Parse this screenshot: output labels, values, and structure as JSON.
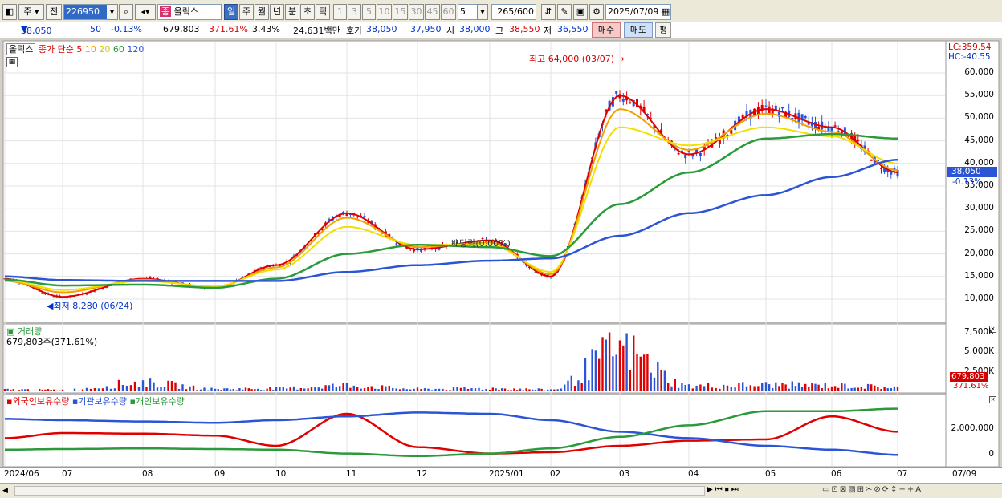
{
  "toolbar": {
    "period_select": "주",
    "prev_label": "전",
    "code": "226950",
    "stock_badge": "종",
    "stock_name": "올릭스",
    "periods": [
      "일",
      "주",
      "월",
      "년",
      "분",
      "초",
      "틱"
    ],
    "active_period": "일",
    "intervals": [
      "1",
      "3",
      "5",
      "10",
      "15",
      "30",
      "45",
      "60"
    ],
    "interval_value": "5",
    "count": "265",
    "count_max": "/600",
    "date": "2025/07/09"
  },
  "quote": {
    "price": "38,050",
    "change": "50",
    "change_pct": "-0.13%",
    "volume": "679,803",
    "vol_ratio": "371.61%",
    "turnover_pct": "3.43%",
    "amount": "24,631백만",
    "hoga_label": "호가",
    "ask": "38,050",
    "bid": "37,950",
    "open_label": "시",
    "open": "38,000",
    "high_label": "고",
    "high": "38,550",
    "low_label": "저",
    "low": "36,550",
    "buy_btn": "매수",
    "sell_btn": "매도",
    "eval_btn": "평"
  },
  "price_panel": {
    "legend_name": "올릭스",
    "legend_ma": "종가 단순",
    "ma_periods": [
      "5",
      "10",
      "20",
      "60",
      "120"
    ],
    "ma_colors": [
      "#e00000",
      "#f0a000",
      "#f0e000",
      "#2a9a3a",
      "#2c55d6"
    ],
    "lc": "LC:359.54",
    "hc": "HC:-40.55",
    "y_ticks": [
      "60,000",
      "55,000",
      "50,000",
      "45,000",
      "40,000",
      "35,000",
      "30,000",
      "25,000",
      "20,000",
      "15,000",
      "10,000"
    ],
    "current_price": "38,050",
    "current_change": "-0.13%",
    "max_label": "최고 64,000 (03/07)",
    "min_label": "최저 8,280 (06/24)",
    "event_label": "배당락(0.00%)"
  },
  "volume_panel": {
    "title": "거래량",
    "summary": "679,803주(371.61%)",
    "y_ticks": [
      "7,500K",
      "5,000K",
      "2,500K"
    ],
    "last_volume": "679,803",
    "last_ratio": "371.61%"
  },
  "holding_panel": {
    "legends": [
      "외국인보유수량",
      "기관보유수량",
      "개인보유수량"
    ],
    "legend_colors": [
      "#e00000",
      "#2c55d6",
      "#2a9a3a"
    ],
    "y_ticks": [
      "2,000,000",
      "0"
    ]
  },
  "x_axis": [
    "2024/06",
    "07",
    "08",
    "09",
    "10",
    "11",
    "12",
    "2025/01",
    "02",
    "03",
    "04",
    "05",
    "06",
    "07"
  ],
  "x_axis_last": "07/09",
  "chart_data": {
    "type": "line",
    "title": "",
    "ylabel": "",
    "ylim": [
      5000,
      63000
    ],
    "x": [
      "2024/06",
      "07",
      "08",
      "09",
      "10",
      "11",
      "12",
      "2025/01",
      "02",
      "03",
      "04",
      "05",
      "06",
      "07"
    ],
    "series": [
      {
        "name": "5",
        "values": [
          14500,
          10500,
          14500,
          12500,
          17500,
          29000,
          21000,
          23000,
          15000,
          55000,
          42000,
          52000,
          48000,
          38000
        ]
      },
      {
        "name": "10",
        "values": [
          14000,
          11500,
          14300,
          12600,
          17000,
          28000,
          21500,
          22500,
          15500,
          52000,
          43000,
          51000,
          47000,
          38500
        ]
      },
      {
        "name": "20",
        "values": [
          14200,
          12000,
          14000,
          12800,
          16500,
          26000,
          22000,
          22000,
          16000,
          48000,
          44000,
          48000,
          46000,
          40000
        ]
      },
      {
        "name": "60",
        "values": [
          14300,
          13000,
          13200,
          12500,
          14500,
          20000,
          22000,
          21500,
          19500,
          31000,
          38000,
          45500,
          46500,
          45500
        ]
      },
      {
        "name": "120",
        "values": [
          15000,
          14200,
          14000,
          14000,
          14000,
          16000,
          17500,
          18500,
          19000,
          24000,
          29000,
          33000,
          37000,
          40800
        ]
      }
    ],
    "volume_k": [
      300,
      250,
      1500,
      400,
      500,
      1000,
      400,
      500,
      300,
      7000,
      900,
      1100,
      1000,
      680
    ],
    "foreign_holding": [
      1300000,
      1700000,
      1650000,
      1500000,
      700000,
      3200000,
      600000,
      100000,
      200000,
      700000,
      1100000,
      1200000,
      3000000,
      1800000
    ],
    "inst_holding": [
      2800000,
      2700000,
      2600000,
      2500000,
      2700000,
      3000000,
      3300000,
      3200000,
      2700000,
      1800000,
      1300000,
      700000,
      400000,
      0
    ],
    "indiv_holding": [
      400000,
      450000,
      500000,
      450000,
      400000,
      100000,
      -100000,
      100000,
      500000,
      1400000,
      2300000,
      3400000,
      3400000,
      3600000
    ]
  }
}
